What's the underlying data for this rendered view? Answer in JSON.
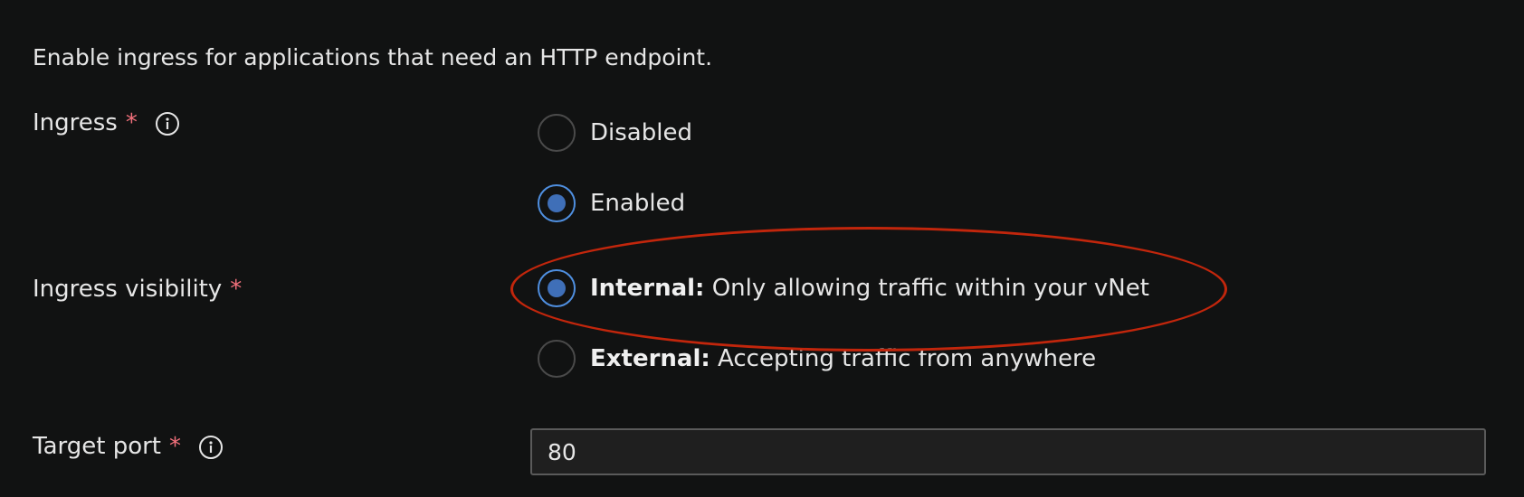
{
  "description": "Enable ingress for applications that need an HTTP endpoint.",
  "ingress": {
    "label": "Ingress",
    "required_mark": "*",
    "options": [
      {
        "label": "Disabled",
        "checked": false
      },
      {
        "label": "Enabled",
        "checked": true
      }
    ]
  },
  "visibility": {
    "label": "Ingress visibility",
    "required_mark": "*",
    "options": [
      {
        "title": "Internal:",
        "detail": "Only allowing traffic within your vNet",
        "checked": true
      },
      {
        "title": "External:",
        "detail": "Accepting traffic from anywhere",
        "checked": false
      }
    ]
  },
  "target_port": {
    "label": "Target port",
    "required_mark": "*",
    "value": "80"
  },
  "colors": {
    "background": "#111212",
    "accent": "#3f6fb8",
    "required": "#f1707b",
    "highlight": "#c2260c"
  },
  "icons": {
    "info": "info-icon"
  }
}
